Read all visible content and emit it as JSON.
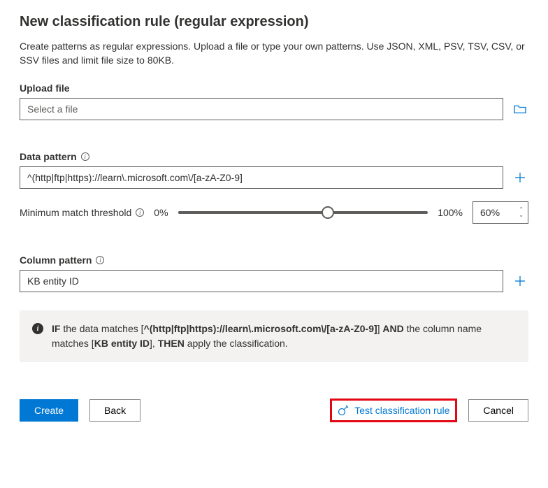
{
  "page": {
    "title": "New classification rule (regular expression)",
    "description": "Create patterns as regular expressions. Upload a file or type your own patterns. Use JSON, XML, PSV, TSV, CSV, or SSV files and limit file size to 80KB."
  },
  "upload": {
    "label": "Upload file",
    "placeholder": "Select a file",
    "value": ""
  },
  "dataPattern": {
    "label": "Data pattern",
    "value": "^(http|ftp|https)://learn\\.microsoft.com\\/[a-zA-Z0-9]"
  },
  "threshold": {
    "label": "Minimum match threshold",
    "minLabel": "0%",
    "maxLabel": "100%",
    "value": "60%",
    "percent": 60
  },
  "columnPattern": {
    "label": "Column pattern",
    "value": "KB entity ID"
  },
  "rule": {
    "if": "IF",
    "text1": " the data matches [",
    "pattern1": "^(http|ftp|https)://learn\\.microsoft.com\\/[a-zA-Z0-9]",
    "text2": "] ",
    "and": "AND",
    "text3": " the column name matches [",
    "pattern2": "KB entity ID",
    "text4": "], ",
    "then": "THEN",
    "text5": " apply the classification."
  },
  "footer": {
    "create": "Create",
    "back": "Back",
    "test": "Test classification rule",
    "cancel": "Cancel"
  }
}
